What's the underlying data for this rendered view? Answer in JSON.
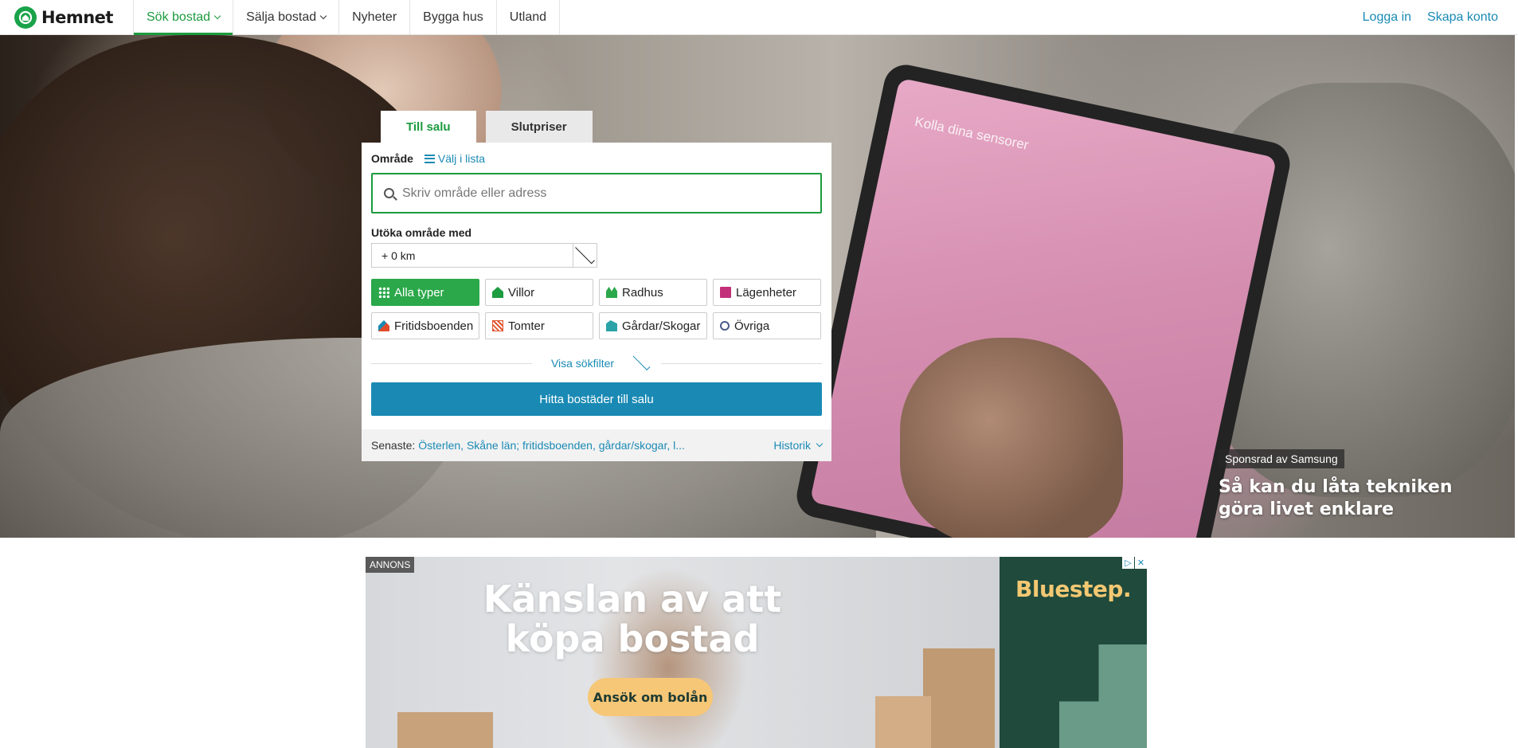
{
  "brand": {
    "name": "Hemnet",
    "color": "#1c9b3f"
  },
  "nav": {
    "items": [
      {
        "label": "Sök bostad",
        "active": true,
        "dropdown": true
      },
      {
        "label": "Sälja bostad",
        "active": false,
        "dropdown": true
      },
      {
        "label": "Nyheter",
        "active": false,
        "dropdown": false
      },
      {
        "label": "Bygga hus",
        "active": false,
        "dropdown": false
      },
      {
        "label": "Utland",
        "active": false,
        "dropdown": false
      }
    ],
    "login": "Logga in",
    "signup": "Skapa konto"
  },
  "search": {
    "tabs": [
      "Till salu",
      "Slutpriser"
    ],
    "area_label": "Område",
    "list_link": "Välj i lista",
    "placeholder": "Skriv område eller adress",
    "expand_label": "Utöka område med",
    "expand_value": "+ 0 km",
    "types": [
      {
        "label": "Alla typer",
        "icon": "grid-icon",
        "active": true
      },
      {
        "label": "Villor",
        "icon": "house-icon",
        "active": false
      },
      {
        "label": "Radhus",
        "icon": "rowhouse-icon",
        "active": false
      },
      {
        "label": "Lägenheter",
        "icon": "apartment-icon",
        "active": false
      },
      {
        "label": "Fritidsboenden",
        "icon": "cabin-icon",
        "active": false
      },
      {
        "label": "Tomter",
        "icon": "lot-icon",
        "active": false
      },
      {
        "label": "Gårdar/Skogar",
        "icon": "farm-icon",
        "active": false
      },
      {
        "label": "Övriga",
        "icon": "other-icon",
        "active": false
      }
    ],
    "filters_link": "Visa sökfilter",
    "submit": "Hitta bostäder till salu",
    "recent_label": "Senaste:",
    "recent_value": "Österlen, Skåne län; fritidsboenden, gårdar/skogar, l...",
    "history": "Historik"
  },
  "hero": {
    "tablet_title": "Kolla dina sensorer",
    "sponsor_tag": "Sponsrad av Samsung",
    "sponsor_title": "Så kan du låta tekniken göra livet enklare"
  },
  "ad": {
    "tag": "ANNONS",
    "headline": "Känslan av att köpa bostad",
    "button": "Ansök om bolån",
    "brand": "Bluestep."
  },
  "colors": {
    "accent": "#1a8ab4",
    "green": "#2ba84a"
  }
}
